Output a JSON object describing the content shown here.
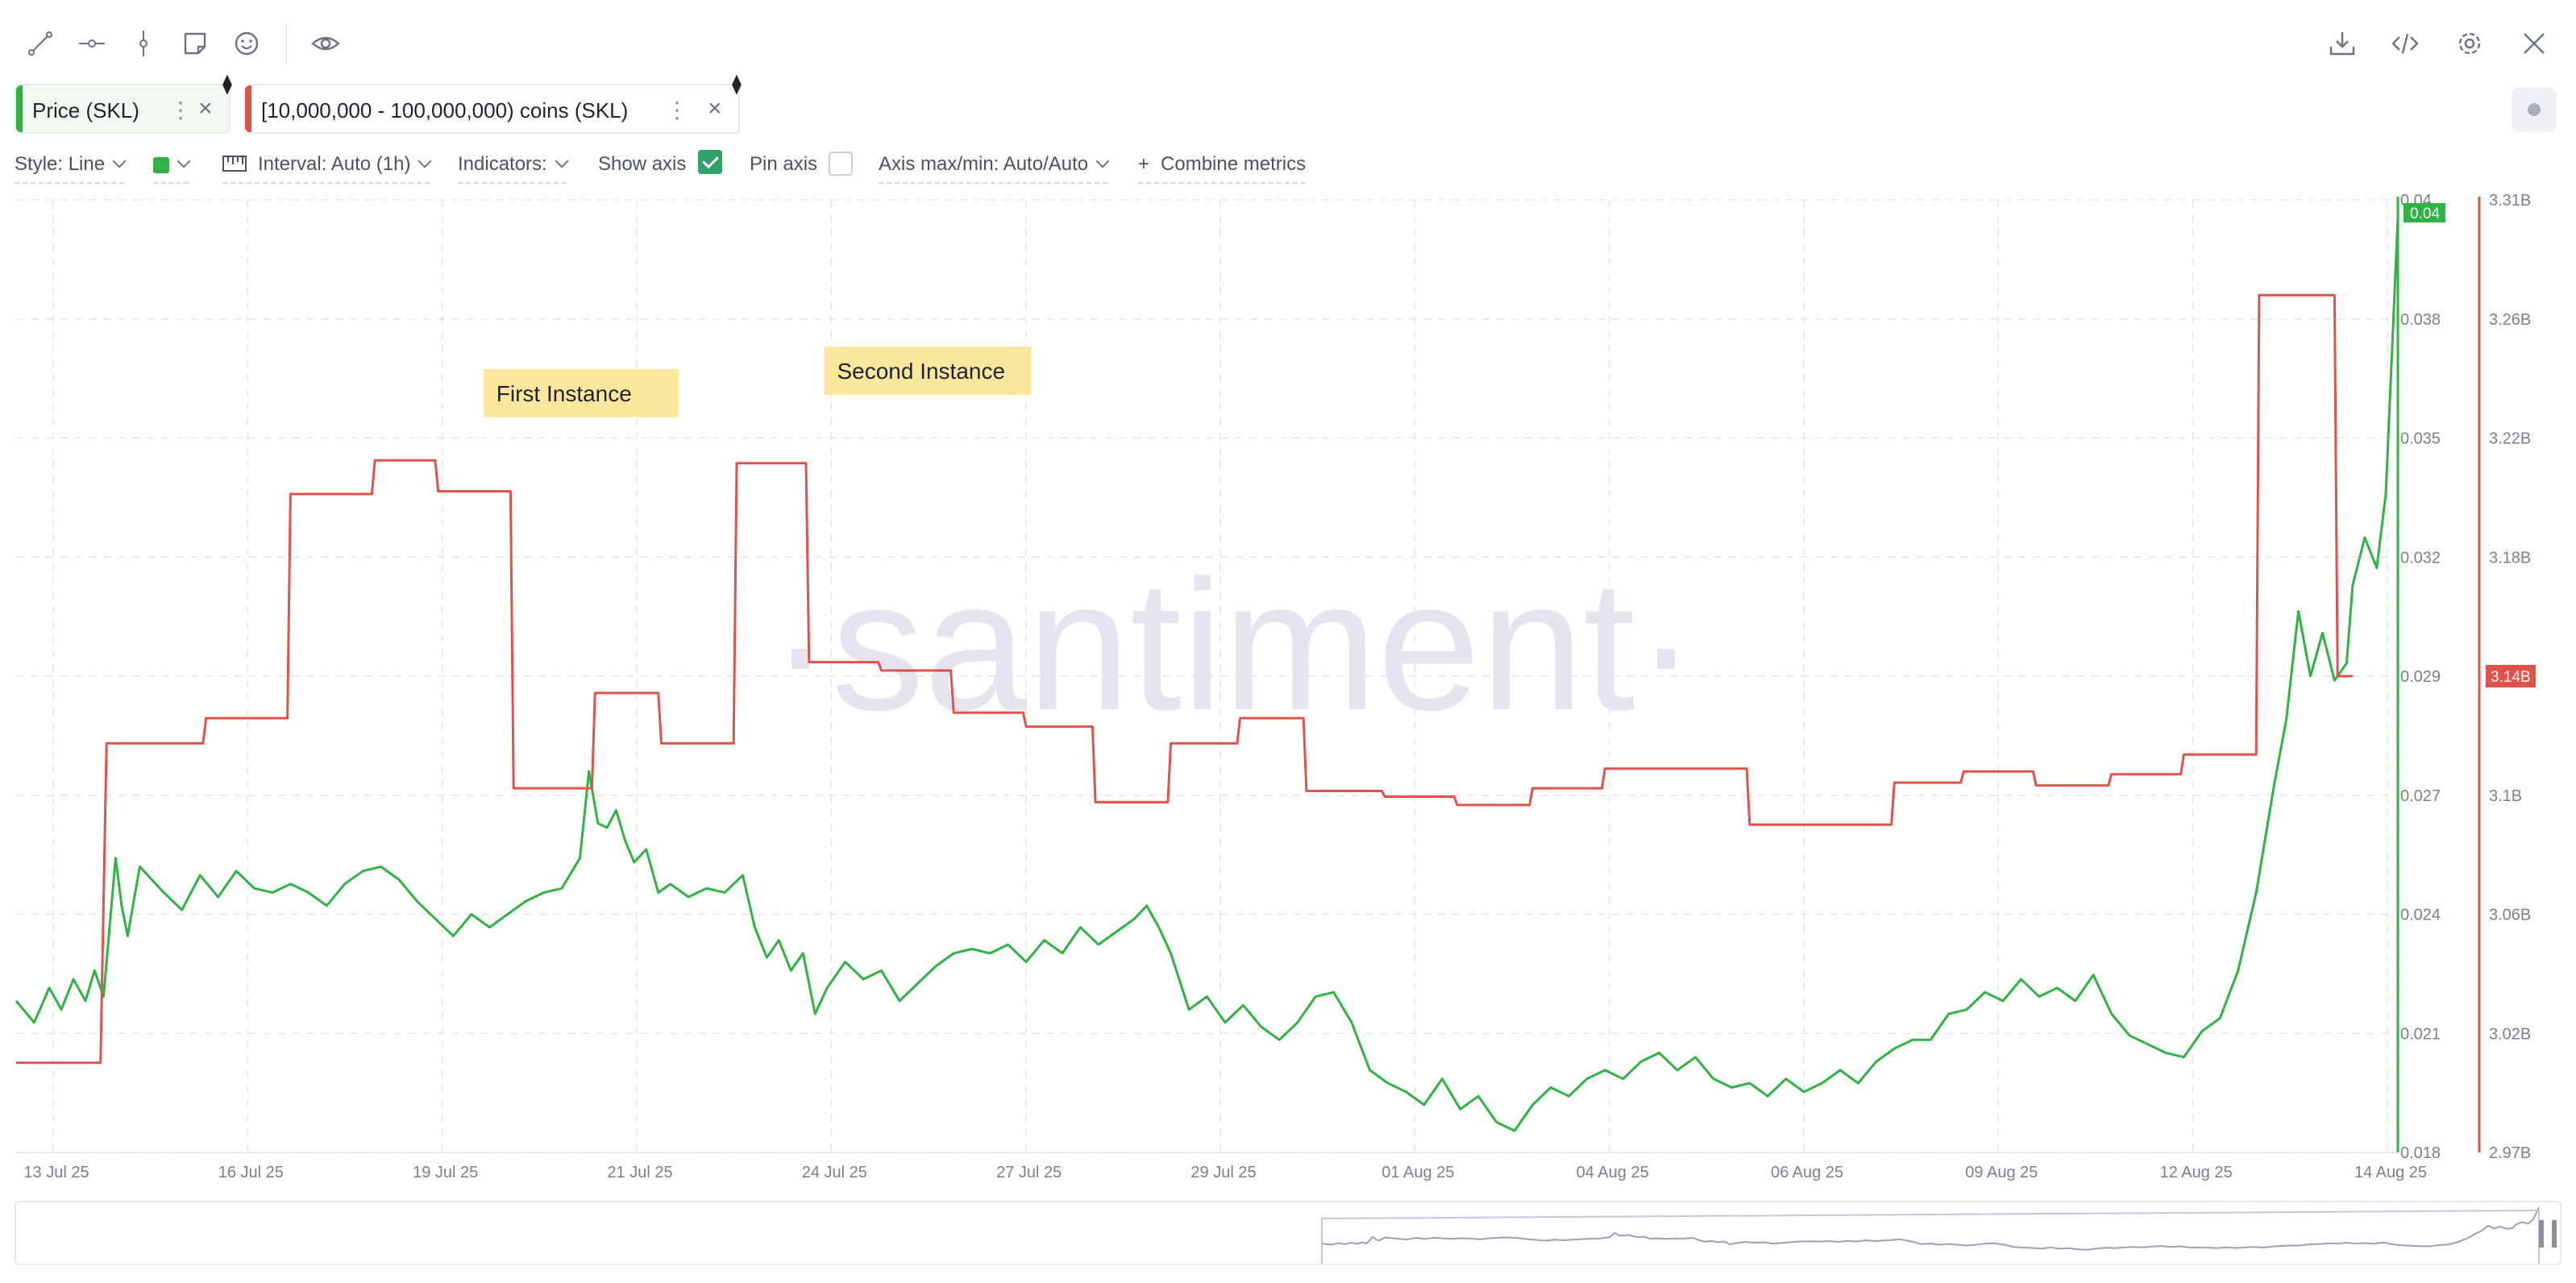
{
  "toolbar": {
    "left_icons": [
      "line-tool-icon",
      "horizontal-ray-icon",
      "vertical-line-icon",
      "note-icon",
      "emoji-icon",
      "eye-icon"
    ],
    "right_icons": [
      "download-icon",
      "embed-code-icon",
      "settings-gear-icon",
      "close-icon"
    ]
  },
  "metrics": [
    {
      "label": "Price (SKL)",
      "color": "#2fb344"
    },
    {
      "label": "[10,000,000 - 100,000,000) coins (SKL)",
      "color": "#e0524a"
    }
  ],
  "settings": {
    "style": "Style: Line",
    "interval": "Interval: Auto (1h)",
    "indicators": "Indicators:",
    "show_axis": "Show axis",
    "show_axis_checked": true,
    "pin_axis": "Pin axis",
    "pin_axis_checked": false,
    "axis_minmax": "Axis max/min: Auto/Auto",
    "combine": "Combine metrics",
    "combine_prefix": "+"
  },
  "chart_data": {
    "type": "line",
    "watermark": "·santiment·",
    "x_ticks": [
      "13 Jul 25",
      "16 Jul 25",
      "19 Jul 25",
      "21 Jul 25",
      "24 Jul 25",
      "27 Jul 25",
      "29 Jul 25",
      "01 Aug 25",
      "04 Aug 25",
      "06 Aug 25",
      "09 Aug 25",
      "12 Aug 25",
      "14 Aug 25"
    ],
    "x_range": [
      "2025-07-12 23:00",
      "2025-08-14 21:00"
    ],
    "left_axis": {
      "ticks": [
        "0.04",
        "0.038",
        "0.035",
        "0.032",
        "0.029",
        "0.027",
        "0.024",
        "0.021",
        "0.018"
      ],
      "min": 0.018,
      "max": 0.04,
      "current": "0.04",
      "color": "#2fb344"
    },
    "right_axis": {
      "ticks": [
        "3.31B",
        "3.26B",
        "3.22B",
        "3.18B",
        "3.14B",
        "3.1B",
        "3.06B",
        "3.02B",
        "2.97B"
      ],
      "min": 2.97,
      "max": 3.31,
      "unit": "B",
      "current": "3.14B",
      "color": "#e0524a"
    },
    "grid": true,
    "series": [
      {
        "name": "Price (SKL)",
        "axis": "left",
        "color": "#2fb344",
        "points": [
          [
            "2025-07-12 23:00",
            0.0215
          ],
          [
            "2025-07-13 05:00",
            0.021
          ],
          [
            "2025-07-13 10:00",
            0.0218
          ],
          [
            "2025-07-13 14:00",
            0.0213
          ],
          [
            "2025-07-13 18:00",
            0.022
          ],
          [
            "2025-07-13 22:00",
            0.0215
          ],
          [
            "2025-07-14 01:00",
            0.0222
          ],
          [
            "2025-07-14 04:00",
            0.0216
          ],
          [
            "2025-07-14 08:00",
            0.0248
          ],
          [
            "2025-07-14 10:00",
            0.0237
          ],
          [
            "2025-07-14 12:00",
            0.023
          ],
          [
            "2025-07-14 16:00",
            0.0246
          ],
          [
            "2025-07-15 00:00",
            0.024
          ],
          [
            "2025-07-15 06:00",
            0.0236
          ],
          [
            "2025-07-15 12:00",
            0.0244
          ],
          [
            "2025-07-15 18:00",
            0.0239
          ],
          [
            "2025-07-16 00:00",
            0.0245
          ],
          [
            "2025-07-16 06:00",
            0.0241
          ],
          [
            "2025-07-16 12:00",
            0.024
          ],
          [
            "2025-07-16 18:00",
            0.0242
          ],
          [
            "2025-07-17 00:00",
            0.024
          ],
          [
            "2025-07-17 06:00",
            0.0237
          ],
          [
            "2025-07-17 12:00",
            0.0242
          ],
          [
            "2025-07-17 18:00",
            0.0245
          ],
          [
            "2025-07-18 00:00",
            0.0246
          ],
          [
            "2025-07-18 06:00",
            0.0243
          ],
          [
            "2025-07-18 12:00",
            0.0238
          ],
          [
            "2025-07-18 18:00",
            0.0234
          ],
          [
            "2025-07-19 00:00",
            0.023
          ],
          [
            "2025-07-19 06:00",
            0.0235
          ],
          [
            "2025-07-19 12:00",
            0.0232
          ],
          [
            "2025-07-19 18:00",
            0.0235
          ],
          [
            "2025-07-20 00:00",
            0.0238
          ],
          [
            "2025-07-20 06:00",
            0.024
          ],
          [
            "2025-07-20 12:00",
            0.0241
          ],
          [
            "2025-07-20 18:00",
            0.0248
          ],
          [
            "2025-07-20 21:00",
            0.0268
          ],
          [
            "2025-07-21 00:00",
            0.0256
          ],
          [
            "2025-07-21 03:00",
            0.0255
          ],
          [
            "2025-07-21 06:00",
            0.0259
          ],
          [
            "2025-07-21 09:00",
            0.0252
          ],
          [
            "2025-07-21 12:00",
            0.0247
          ],
          [
            "2025-07-21 16:00",
            0.025
          ],
          [
            "2025-07-21 20:00",
            0.024
          ],
          [
            "2025-07-22 00:00",
            0.0242
          ],
          [
            "2025-07-22 06:00",
            0.0239
          ],
          [
            "2025-07-22 12:00",
            0.0241
          ],
          [
            "2025-07-22 18:00",
            0.024
          ],
          [
            "2025-07-23 00:00",
            0.0244
          ],
          [
            "2025-07-23 04:00",
            0.0232
          ],
          [
            "2025-07-23 08:00",
            0.0225
          ],
          [
            "2025-07-23 12:00",
            0.0229
          ],
          [
            "2025-07-23 16:00",
            0.0222
          ],
          [
            "2025-07-23 20:00",
            0.0226
          ],
          [
            "2025-07-24 00:00",
            0.0212
          ],
          [
            "2025-07-24 04:00",
            0.0218
          ],
          [
            "2025-07-24 10:00",
            0.0224
          ],
          [
            "2025-07-24 16:00",
            0.022
          ],
          [
            "2025-07-24 22:00",
            0.0222
          ],
          [
            "2025-07-25 04:00",
            0.0215
          ],
          [
            "2025-07-25 10:00",
            0.0219
          ],
          [
            "2025-07-25 16:00",
            0.0223
          ],
          [
            "2025-07-25 22:00",
            0.0226
          ],
          [
            "2025-07-26 04:00",
            0.0227
          ],
          [
            "2025-07-26 10:00",
            0.0226
          ],
          [
            "2025-07-26 16:00",
            0.0228
          ],
          [
            "2025-07-26 22:00",
            0.0224
          ],
          [
            "2025-07-27 04:00",
            0.0229
          ],
          [
            "2025-07-27 10:00",
            0.0226
          ],
          [
            "2025-07-27 16:00",
            0.0232
          ],
          [
            "2025-07-27 22:00",
            0.0228
          ],
          [
            "2025-07-28 04:00",
            0.0231
          ],
          [
            "2025-07-28 10:00",
            0.0234
          ],
          [
            "2025-07-28 14:00",
            0.0237
          ],
          [
            "2025-07-28 18:00",
            0.0232
          ],
          [
            "2025-07-28 22:00",
            0.0226
          ],
          [
            "2025-07-29 04:00",
            0.0213
          ],
          [
            "2025-07-29 10:00",
            0.0216
          ],
          [
            "2025-07-29 16:00",
            0.021
          ],
          [
            "2025-07-29 22:00",
            0.0214
          ],
          [
            "2025-07-30 04:00",
            0.0209
          ],
          [
            "2025-07-30 10:00",
            0.0206
          ],
          [
            "2025-07-30 16:00",
            0.021
          ],
          [
            "2025-07-30 22:00",
            0.0216
          ],
          [
            "2025-07-31 04:00",
            0.0217
          ],
          [
            "2025-07-31 10:00",
            0.021
          ],
          [
            "2025-07-31 16:00",
            0.0199
          ],
          [
            "2025-07-31 22:00",
            0.0196
          ],
          [
            "2025-08-01 04:00",
            0.0194
          ],
          [
            "2025-08-01 10:00",
            0.0191
          ],
          [
            "2025-08-01 16:00",
            0.0197
          ],
          [
            "2025-08-01 22:00",
            0.019
          ],
          [
            "2025-08-02 04:00",
            0.0193
          ],
          [
            "2025-08-02 10:00",
            0.0187
          ],
          [
            "2025-08-02 16:00",
            0.0185
          ],
          [
            "2025-08-02 22:00",
            0.0191
          ],
          [
            "2025-08-03 04:00",
            0.0195
          ],
          [
            "2025-08-03 10:00",
            0.0193
          ],
          [
            "2025-08-03 16:00",
            0.0197
          ],
          [
            "2025-08-03 22:00",
            0.0199
          ],
          [
            "2025-08-04 04:00",
            0.0197
          ],
          [
            "2025-08-04 10:00",
            0.0201
          ],
          [
            "2025-08-04 16:00",
            0.0203
          ],
          [
            "2025-08-04 22:00",
            0.0199
          ],
          [
            "2025-08-05 04:00",
            0.0202
          ],
          [
            "2025-08-05 10:00",
            0.0197
          ],
          [
            "2025-08-05 16:00",
            0.0195
          ],
          [
            "2025-08-05 22:00",
            0.0196
          ],
          [
            "2025-08-06 04:00",
            0.0193
          ],
          [
            "2025-08-06 10:00",
            0.0197
          ],
          [
            "2025-08-06 16:00",
            0.0194
          ],
          [
            "2025-08-06 22:00",
            0.0196
          ],
          [
            "2025-08-07 04:00",
            0.0199
          ],
          [
            "2025-08-07 10:00",
            0.0196
          ],
          [
            "2025-08-07 16:00",
            0.0201
          ],
          [
            "2025-08-07 22:00",
            0.0204
          ],
          [
            "2025-08-08 04:00",
            0.0206
          ],
          [
            "2025-08-08 10:00",
            0.0206
          ],
          [
            "2025-08-08 16:00",
            0.0212
          ],
          [
            "2025-08-08 22:00",
            0.0213
          ],
          [
            "2025-08-09 04:00",
            0.0217
          ],
          [
            "2025-08-09 10:00",
            0.0215
          ],
          [
            "2025-08-09 16:00",
            0.022
          ],
          [
            "2025-08-09 22:00",
            0.0216
          ],
          [
            "2025-08-10 04:00",
            0.0218
          ],
          [
            "2025-08-10 10:00",
            0.0215
          ],
          [
            "2025-08-10 16:00",
            0.0221
          ],
          [
            "2025-08-10 22:00",
            0.0212
          ],
          [
            "2025-08-11 04:00",
            0.0207
          ],
          [
            "2025-08-11 10:00",
            0.0205
          ],
          [
            "2025-08-11 16:00",
            0.0203
          ],
          [
            "2025-08-11 22:00",
            0.0202
          ],
          [
            "2025-08-12 04:00",
            0.0208
          ],
          [
            "2025-08-12 10:00",
            0.0211
          ],
          [
            "2025-08-12 16:00",
            0.0222
          ],
          [
            "2025-08-12 22:00",
            0.024
          ],
          [
            "2025-08-13 04:00",
            0.0265
          ],
          [
            "2025-08-13 08:00",
            0.028
          ],
          [
            "2025-08-13 12:00",
            0.0305
          ],
          [
            "2025-08-13 16:00",
            0.029
          ],
          [
            "2025-08-13 20:00",
            0.03
          ],
          [
            "2025-08-14 00:00",
            0.0289
          ],
          [
            "2025-08-14 04:00",
            0.0293
          ],
          [
            "2025-08-14 06:00",
            0.0311
          ],
          [
            "2025-08-14 10:00",
            0.0322
          ],
          [
            "2025-08-14 14:00",
            0.0315
          ],
          [
            "2025-08-14 17:00",
            0.0332
          ],
          [
            "2025-08-14 21:00",
            0.0396
          ]
        ]
      },
      {
        "name": "[10,000,000 - 100,000,000) coins (SKL)",
        "axis": "right",
        "color": "#e0524a",
        "points": [
          [
            "2025-07-12 23:00",
            3.002
          ],
          [
            "2025-07-14 03:00",
            3.002
          ],
          [
            "2025-07-14 05:00",
            3.116
          ],
          [
            "2025-07-15 13:00",
            3.116
          ],
          [
            "2025-07-15 14:00",
            3.125
          ],
          [
            "2025-07-16 17:00",
            3.125
          ],
          [
            "2025-07-16 18:00",
            3.205
          ],
          [
            "2025-07-17 21:00",
            3.205
          ],
          [
            "2025-07-17 22:00",
            3.217
          ],
          [
            "2025-07-18 18:00",
            3.217
          ],
          [
            "2025-07-18 19:00",
            3.206
          ],
          [
            "2025-07-19 19:00",
            3.206
          ],
          [
            "2025-07-19 20:00",
            3.1
          ],
          [
            "2025-07-20 22:00",
            3.1
          ],
          [
            "2025-07-20 23:00",
            3.134
          ],
          [
            "2025-07-21 20:00",
            3.134
          ],
          [
            "2025-07-21 21:00",
            3.116
          ],
          [
            "2025-07-22 21:00",
            3.116
          ],
          [
            "2025-07-22 22:00",
            3.216
          ],
          [
            "2025-07-23 21:00",
            3.216
          ],
          [
            "2025-07-23 22:00",
            3.145
          ],
          [
            "2025-07-24 21:00",
            3.145
          ],
          [
            "2025-07-24 22:00",
            3.142
          ],
          [
            "2025-07-25 21:00",
            3.142
          ],
          [
            "2025-07-25 22:00",
            3.127
          ],
          [
            "2025-07-26 21:00",
            3.127
          ],
          [
            "2025-07-26 22:00",
            3.122
          ],
          [
            "2025-07-27 20:00",
            3.122
          ],
          [
            "2025-07-27 21:00",
            3.095
          ],
          [
            "2025-07-28 21:00",
            3.095
          ],
          [
            "2025-07-28 22:00",
            3.116
          ],
          [
            "2025-07-29 20:00",
            3.116
          ],
          [
            "2025-07-29 21:00",
            3.125
          ],
          [
            "2025-07-30 18:00",
            3.125
          ],
          [
            "2025-07-30 19:00",
            3.099
          ],
          [
            "2025-07-31 20:00",
            3.099
          ],
          [
            "2025-07-31 21:00",
            3.097
          ],
          [
            "2025-08-01 20:00",
            3.097
          ],
          [
            "2025-08-01 21:00",
            3.094
          ],
          [
            "2025-08-02 21:00",
            3.094
          ],
          [
            "2025-08-02 22:00",
            3.1
          ],
          [
            "2025-08-03 21:00",
            3.1
          ],
          [
            "2025-08-03 22:00",
            3.107
          ],
          [
            "2025-08-05 21:00",
            3.107
          ],
          [
            "2025-08-05 22:00",
            3.087
          ],
          [
            "2025-08-07 21:00",
            3.087
          ],
          [
            "2025-08-07 22:00",
            3.102
          ],
          [
            "2025-08-08 20:00",
            3.102
          ],
          [
            "2025-08-08 21:00",
            3.106
          ],
          [
            "2025-08-09 20:00",
            3.106
          ],
          [
            "2025-08-09 21:00",
            3.101
          ],
          [
            "2025-08-10 21:00",
            3.101
          ],
          [
            "2025-08-10 22:00",
            3.105
          ],
          [
            "2025-08-11 21:00",
            3.105
          ],
          [
            "2025-08-11 22:00",
            3.112
          ],
          [
            "2025-08-12 22:00",
            3.112
          ],
          [
            "2025-08-12 23:00",
            3.276
          ],
          [
            "2025-08-14 00:00",
            3.276
          ],
          [
            "2025-08-14 01:00",
            3.14
          ],
          [
            "2025-08-14 06:00",
            3.14
          ]
        ]
      }
    ],
    "annotations": [
      {
        "text": "First Instance",
        "x": "2025-07-19 10:00",
        "y_right": 3.241
      },
      {
        "text": "Second Instance",
        "x": "2025-07-24 03:00",
        "y_right": 3.249
      }
    ]
  },
  "navigator": {
    "line_color": "#9aa0b5"
  }
}
